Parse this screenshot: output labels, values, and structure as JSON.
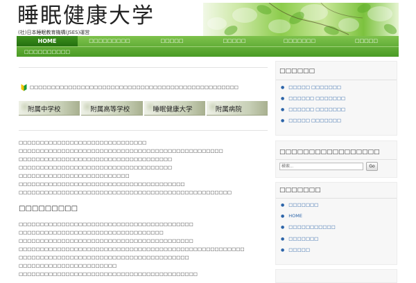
{
  "header": {
    "site_title": "睡眠健康大学",
    "subtitle": "(社)日本睡眠教育機構(JSES)運営"
  },
  "nav": {
    "items": [
      {
        "label": "HOME",
        "active": true
      },
      {
        "label": "□□□□□□□□□",
        "active": false
      },
      {
        "label": "□□□□□",
        "active": false
      },
      {
        "label": "□□□□□",
        "active": false
      },
      {
        "label": "□□□□□□□",
        "active": false
      },
      {
        "label": "□□□□□",
        "active": false
      },
      {
        "label": "□□□□□□□□□□",
        "active": false
      }
    ]
  },
  "main": {
    "notice": "□□□□□□□□□□□□□□□□□□□□□□□□□□□□□□□□□□□□□□□□□□□□□□□□□",
    "schools": [
      "附属中学校",
      "附属高等学校",
      "睡眠健康大学",
      "附属病院"
    ],
    "intro_lines": [
      "□□□□□□□□□□□□□□□□□□□□□□□□□□□□□□",
      "□□□□□□□□□□□□□□□□□□□□□□□□□□□□□□□□□□□□□□□□□□□□□□□□",
      "□□□□□□□□□□□□□□□□□□□□□□□□□□□□□□□□□□□□",
      "□□□□□□□□□□□□□□□□□□□□□□□□□□□□□□□□□□□□",
      "□□□□□□□□□□□□□□□□□□□□□□□□□□",
      "□□□□□□□□□□□□□□□□□□□□□□□□□□□□□□□□□□□□□□□",
      "□□□□□□□□□□□□□□□□□□□□□□□□□□□□□□□□□□□□□□□□□□□□□□□□□□"
    ],
    "section_heading": "□□□□□□□□□",
    "body_lines": [
      "□□□□□□□□□□□□□□□□□□□□□□□□□□□□□□□□□□□□□□□□□",
      "□□□□□□□□□□□□□□□□□□□□□□□□□□□□□□□□□□",
      "□□□□□□□□□□□□□□□□□□□□□□□□□□□□□□□□□□□□□□□□□",
      "□□□□□□□□□□□□□□□□□□□□□□□□□□□□□□□□□□□□□□□□□□□□□□□□□□□□□",
      "□□□□□□□□□□□□□□□□□□□□□□□□□□□□□□□□□□□□□□□□",
      "□□□□□□□□□□□□□□□□□□□□□□□",
      "□□□□□□□□□□□□□□□□□□□□□□□□□□□□□□□□□□□□□□□□□□"
    ]
  },
  "sidebar": {
    "box1": {
      "title": "□□□□□□",
      "links": [
        "□□□□□ □□□□□□□",
        "□□□□□□ □□□□□□□",
        "□□□□□□ □□□□□□□",
        "□□□□□ □□□□□□□"
      ]
    },
    "search": {
      "title": "□□□□□□□□□□□□□□□□□",
      "placeholder": "検索...",
      "button": "Go"
    },
    "box3": {
      "title": "□□□□□□□",
      "links": [
        "□□□□□□□",
        "HOME",
        "□□□□□□□□□□□",
        "□□□□□□□",
        "□□□□□"
      ]
    }
  },
  "colors": {
    "nav_green": "#5aaa30",
    "nav_active": "#2f7f16",
    "link_blue": "#2a63a8"
  }
}
